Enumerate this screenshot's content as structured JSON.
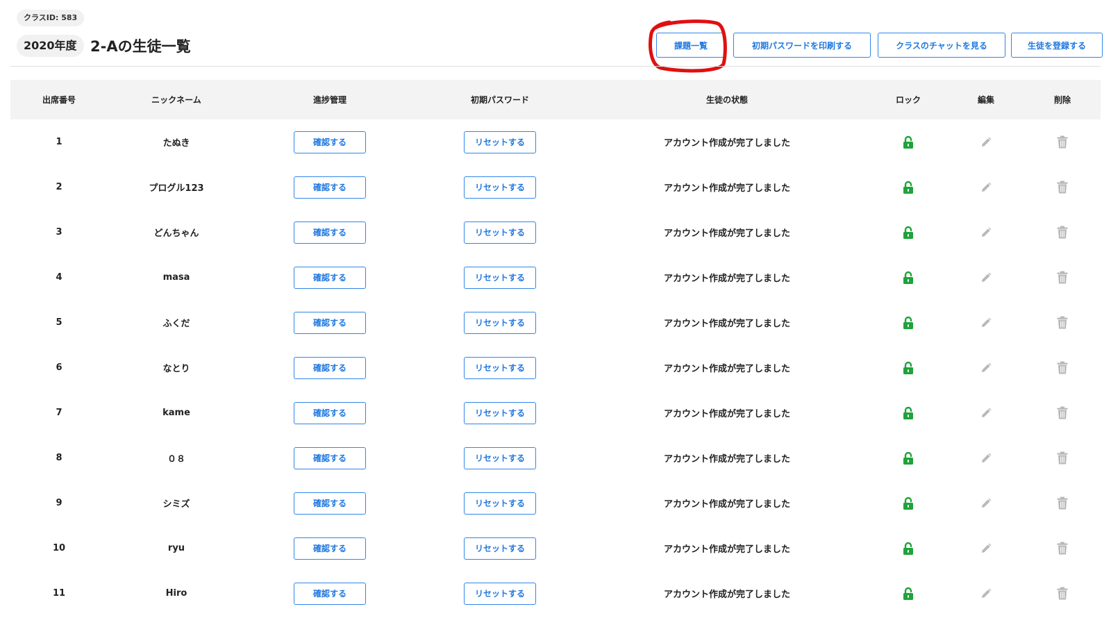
{
  "header": {
    "class_id": "クラスID: 583",
    "year": "2020年度",
    "title": "2-Aの生徒一覧",
    "buttons": {
      "assignments": "課題一覧",
      "print_passwords": "初期パスワードを印刷する",
      "class_chat": "クラスのチャットを見る",
      "register_student": "生徒を登録する"
    }
  },
  "table": {
    "columns": [
      "出席番号",
      "ニックネーム",
      "進捗管理",
      "初期パスワード",
      "生徒の状態",
      "ロック",
      "編集",
      "削除"
    ],
    "progress_button_label": "確認する",
    "reset_button_label": "リセットする",
    "rows": [
      {
        "number": "1",
        "nickname": "たぬき",
        "status": "アカウント作成が完了しました"
      },
      {
        "number": "2",
        "nickname": "プログル123",
        "status": "アカウント作成が完了しました"
      },
      {
        "number": "3",
        "nickname": "どんちゃん",
        "status": "アカウント作成が完了しました"
      },
      {
        "number": "4",
        "nickname": "masa",
        "status": "アカウント作成が完了しました"
      },
      {
        "number": "5",
        "nickname": "ふくだ",
        "status": "アカウント作成が完了しました"
      },
      {
        "number": "6",
        "nickname": "なとり",
        "status": "アカウント作成が完了しました"
      },
      {
        "number": "7",
        "nickname": "kame",
        "status": "アカウント作成が完了しました"
      },
      {
        "number": "8",
        "nickname": "０８",
        "status": "アカウント作成が完了しました"
      },
      {
        "number": "9",
        "nickname": "シミズ",
        "status": "アカウント作成が完了しました"
      },
      {
        "number": "10",
        "nickname": "ryu",
        "status": "アカウント作成が完了しました"
      },
      {
        "number": "11",
        "nickname": "Hiro",
        "status": "アカウント作成が完了しました"
      }
    ]
  },
  "icons": {
    "lock": "unlock-icon",
    "edit": "pencil-icon",
    "delete": "trash-icon"
  },
  "colors": {
    "accent": "#1f78e0",
    "lock_green": "#1fa33b",
    "icon_gray": "#b8b8b8",
    "annotation_red": "#e01010"
  }
}
